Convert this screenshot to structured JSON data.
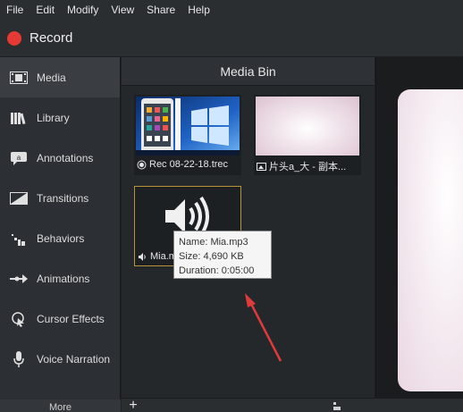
{
  "menubar": {
    "items": [
      "File",
      "Edit",
      "Modify",
      "View",
      "Share",
      "Help"
    ]
  },
  "record": {
    "label": "Record",
    "color": "#e53935"
  },
  "sidebar": {
    "items": [
      {
        "label": "Media",
        "icon": "film-strip-icon",
        "active": true
      },
      {
        "label": "Library",
        "icon": "books-icon"
      },
      {
        "label": "Annotations",
        "icon": "speech-bubble-icon"
      },
      {
        "label": "Transitions",
        "icon": "transition-icon"
      },
      {
        "label": "Behaviors",
        "icon": "behaviors-icon"
      },
      {
        "label": "Animations",
        "icon": "animation-arrow-icon"
      },
      {
        "label": "Cursor Effects",
        "icon": "cursor-effects-icon"
      },
      {
        "label": "Voice Narration",
        "icon": "microphone-icon"
      }
    ],
    "more_label": "More"
  },
  "media_bin": {
    "title": "Media Bin",
    "tiles": [
      {
        "caption": "Rec 08-22-18.trec",
        "icon": "recording-icon"
      },
      {
        "caption": "片头a_大 - 副本...",
        "icon": "image-icon"
      },
      {
        "caption": "Mia.mp3",
        "caption_visible": "Mia.m",
        "icon": "speaker-icon",
        "selected": true
      }
    ]
  },
  "tooltip": {
    "name": "Name: Mia.mp3",
    "size": "Size: 4,690 KB",
    "duration": "Duration: 0:05:00"
  },
  "bottombar": {
    "add_label": "+"
  },
  "colors": {
    "accent_selected": "#b89238",
    "arrow": "#e03a3a"
  }
}
